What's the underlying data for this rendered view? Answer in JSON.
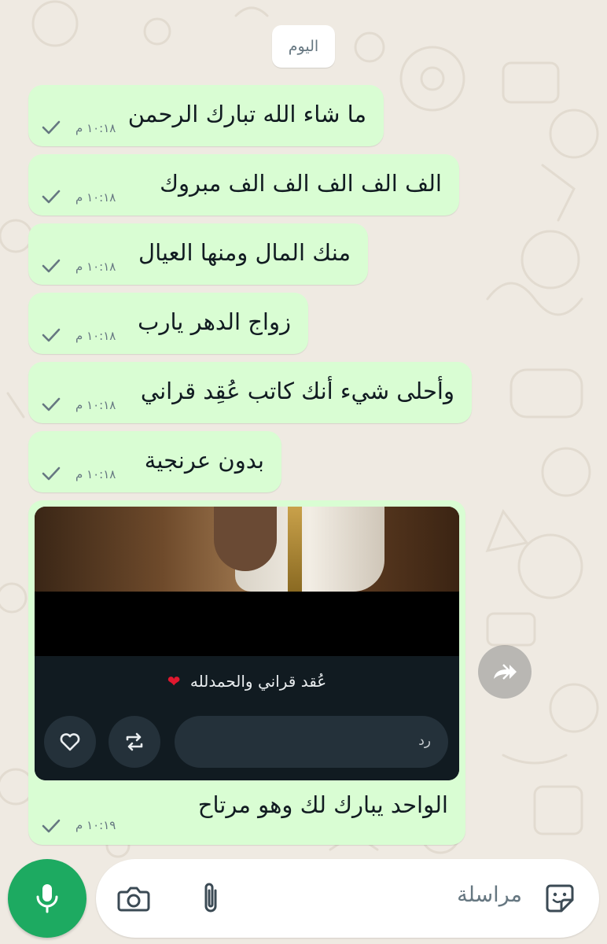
{
  "date_chip": "اليوم",
  "messages": [
    {
      "text": "ما شاء الله تبارك الرحمن",
      "time": "١٠:١٨ م"
    },
    {
      "text": "الف الف الف الف الف مبروك",
      "time": "١٠:١٨ م"
    },
    {
      "text": "منك المال ومنها العيال",
      "time": "١٠:١٨ م"
    },
    {
      "text": "زواج الدهر يارب",
      "time": "١٠:١٨ م"
    },
    {
      "text": "وأحلى شيء أنك كاتب عُقِد قراني",
      "time": "١٠:١٨ م"
    },
    {
      "text": "بدون عرنجية",
      "time": "١٠:١٨ م"
    }
  ],
  "story_reply": {
    "caption": "عُقد قراني والحمدلله",
    "caption_emoji": "❤",
    "reply_placeholder": "رد",
    "text": "الواحد يبارك لك وهو مرتاح",
    "time": "١٠:١٩ م"
  },
  "composer": {
    "placeholder": "مراسلة"
  },
  "colors": {
    "outgoing_bubble": "#d9fdd3",
    "chat_background": "#efeae2",
    "mic_button": "#1daa61",
    "timestamp": "#667781"
  },
  "icons": {
    "sticker": "sticker-icon",
    "attach": "paperclip-icon",
    "camera": "camera-icon",
    "mic": "mic-icon",
    "forward": "forward-icon",
    "like": "heart-icon",
    "repost": "repost-icon",
    "delivered": "single-check-icon"
  }
}
